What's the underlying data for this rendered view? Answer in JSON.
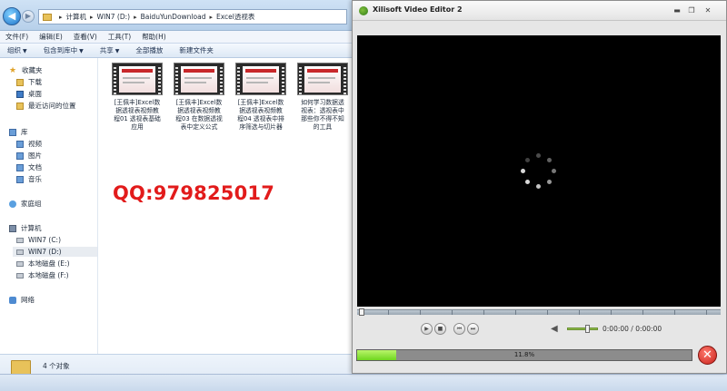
{
  "explorer": {
    "address": {
      "crumbs": [
        "计算机",
        "WIN7 (D:)",
        "BaiduYunDownload",
        "Excel透视表"
      ]
    },
    "menu": [
      "文件(F)",
      "编辑(E)",
      "查看(V)",
      "工具(T)",
      "帮助(H)"
    ],
    "toolbar": {
      "organize": "组织",
      "include_in_library": "包含到库中",
      "share": "共享",
      "play_all": "全部播放",
      "new_folder": "新建文件夹"
    },
    "sidebar": {
      "favorites": "收藏夹",
      "downloads": "下载",
      "desktop": "桌面",
      "recent_places": "最近访问的位置",
      "libraries": "库",
      "videos": "视频",
      "pictures": "图片",
      "documents": "文档",
      "music": "音乐",
      "homegroup": "家庭组",
      "computer": "计算机",
      "drive_c": "WIN7 (C:)",
      "drive_d": "WIN7 (D:)",
      "drive_e": "本地磁盘 (E:)",
      "drive_f": "本地磁盘 (F:)",
      "network": "网络"
    },
    "files": [
      {
        "line1": "[王佩丰]Excel数",
        "line2": "据透视表视频教",
        "line3": "程01 透视表基础",
        "line4": "应用"
      },
      {
        "line1": "[王佩丰]Excel数",
        "line2": "据透视表视频教",
        "line3": "程03 在数据透视",
        "line4": "表中定义公式"
      },
      {
        "line1": "[王佩丰]Excel数",
        "line2": "据透视表视频教",
        "line3": "程04 透视表中排",
        "line4": "序筛选与切片器"
      },
      {
        "line1": "如何学习数据透",
        "line2": "视表：透视表中",
        "line3": "那些你不得不知",
        "line4": "的工具"
      }
    ],
    "watermark": "QQ:979825017",
    "status": "4 个对象"
  },
  "editor": {
    "title": "Xilisoft Video Editor 2",
    "time": "0:00:00 / 0:00:00",
    "progress": {
      "percent": 11.8,
      "label": "11.8%"
    },
    "volume_level": 0.7,
    "colors": {
      "progress_fill": "#6fd61f",
      "cancel": "#c8201a",
      "watermark": "#e21b1b"
    }
  }
}
